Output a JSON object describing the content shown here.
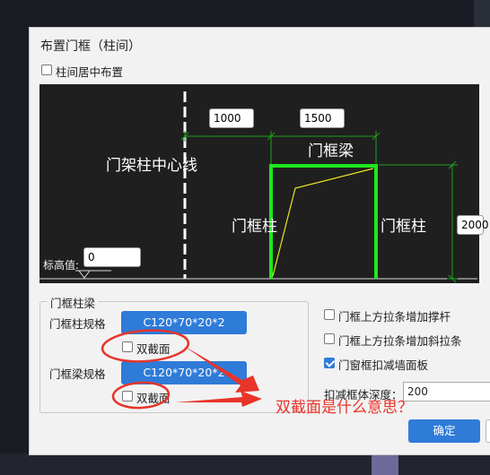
{
  "dialog": {
    "title": "布置门框（柱间）",
    "center_checkbox": {
      "label": "柱间居中布置",
      "checked": false
    }
  },
  "canvas": {
    "dim_left": "1000",
    "dim_width": "1500",
    "dim_height": "2000",
    "elevation_label": "标高值:",
    "elevation_value": "0",
    "label_center_line": "门架柱中心线",
    "label_beam": "门框梁",
    "label_col_left": "门框柱",
    "label_col_right": "门框柱",
    "colors": {
      "frame": "#1ee81e",
      "brace": "#e8e81e",
      "dim": "#1ea01e"
    }
  },
  "column_group": {
    "title": "门框柱梁",
    "column_spec_label": "门框柱规格",
    "column_spec_value": "C120*70*20*2",
    "column_double_label": "双截面",
    "beam_spec_label": "门框梁规格",
    "beam_spec_value": "C120*70*20*2",
    "beam_double_label": "双截面"
  },
  "options": {
    "strut": "门框上方拉条增加撑杆",
    "diagonal": "门框上方拉条增加斜拉条",
    "deduct": "门窗框扣减墙面板",
    "depth_label": "扣减框体深度：",
    "depth_value": "200"
  },
  "buttons": {
    "ok": "确定"
  },
  "annotation": {
    "question": "双截面是什么意思？",
    "color": "#e8342a"
  }
}
